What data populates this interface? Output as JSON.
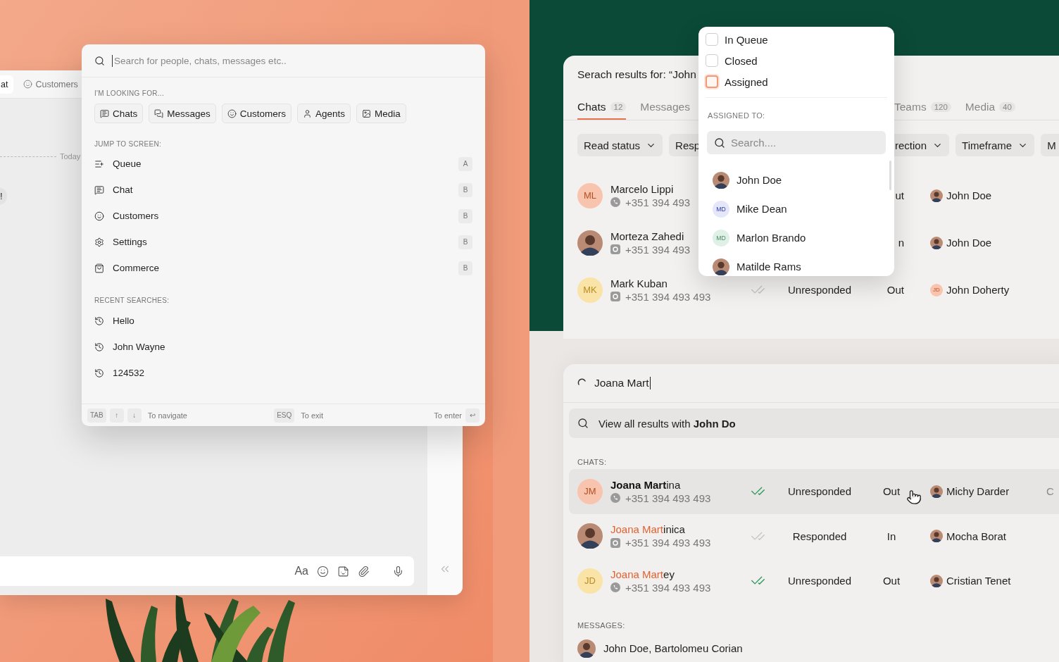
{
  "chat_window": {
    "tabs": [
      {
        "label": "at",
        "selected": true
      },
      {
        "label": "Customers",
        "selected": false
      }
    ],
    "divider_label": "Today",
    "message_fragment": "!",
    "composer": {
      "format_label": "Aa"
    }
  },
  "search_palette": {
    "placeholder": "Search for people, chats, messages etc..",
    "looking_for": {
      "heading": "I'M LOOKING FOR...",
      "chips": [
        "Chats",
        "Messages",
        "Customers",
        "Agents",
        "Media"
      ]
    },
    "jump_to": {
      "heading": "JUMP TO SCREEN:",
      "items": [
        {
          "label": "Queue",
          "key": "A"
        },
        {
          "label": "Chat",
          "key": "B"
        },
        {
          "label": "Customers",
          "key": "B"
        },
        {
          "label": "Settings",
          "key": "B"
        },
        {
          "label": "Commerce",
          "key": "B"
        }
      ]
    },
    "recent": {
      "heading": "RECENT SEARCHES:",
      "items": [
        "Hello",
        "John Wayne",
        "124532"
      ]
    },
    "footer": {
      "navigate_keys": [
        "TAB",
        "↑",
        "↓"
      ],
      "navigate_label": "To navigate",
      "exit_key": "ESQ",
      "exit_label": "To exit",
      "enter_label": "To enter",
      "enter_key": "↩"
    }
  },
  "results_window": {
    "title": "Serach results for: “John",
    "tabs": [
      {
        "label": "Chats",
        "count": "12",
        "selected": true
      },
      {
        "label": "Messages",
        "selected": false
      }
    ],
    "tabs_right": [
      {
        "label": "Teams",
        "count": "120",
        "selected": false
      },
      {
        "label": "Media",
        "count": "40",
        "selected": false
      }
    ],
    "filters": [
      {
        "label": "Read status",
        "caret": true
      },
      {
        "label": "Resp",
        "caret": false
      }
    ],
    "filters_right": [
      {
        "label": "rection",
        "caret": true
      },
      {
        "label": "Timeframe",
        "caret": true
      },
      {
        "label": "M",
        "caret": false
      }
    ],
    "rows": [
      {
        "name": "Marcelo Lippi",
        "phone": {
          "number": "+351 394 493",
          "kind": "whatsapp"
        },
        "avatar": {
          "kind": "initials",
          "text": "ML",
          "color": "#f8c4ad"
        },
        "direction": "ut",
        "agent": {
          "name": "John Doe"
        }
      },
      {
        "name": "Morteza Zahedi",
        "phone": {
          "number": "+351 394 493",
          "kind": "instagram"
        },
        "direction": "n",
        "agent": {
          "name": "John Doe"
        }
      },
      {
        "name": "Mark Kuban",
        "phone": {
          "number": "+351 394 493 493",
          "kind": "instagram"
        },
        "avatar": {
          "kind": "initials",
          "text": "MK",
          "color": "#fae3a6"
        },
        "read": false,
        "status": "Unresponded",
        "direction": "Out",
        "agent": {
          "name": "John Doherty",
          "avatar": {
            "kind": "initials",
            "text": "JD",
            "color": "#f8c4ad"
          }
        }
      }
    ]
  },
  "filter_dropdown": {
    "options": [
      {
        "label": "In Queue",
        "checked": false,
        "focused": false
      },
      {
        "label": "Closed",
        "checked": false,
        "focused": false
      },
      {
        "label": "Assigned",
        "checked": false,
        "focused": true
      }
    ],
    "heading": "ASSIGNED TO:",
    "search_placeholder": "Search....",
    "people": [
      {
        "name": "John Doe"
      },
      {
        "name": "Mike Dean",
        "avatar": {
          "kind": "initials",
          "text": "MD",
          "color": "#e4e6fa"
        }
      },
      {
        "name": "Marlon Brando",
        "avatar": {
          "kind": "initials",
          "text": "MD",
          "color": "#dff0e6"
        }
      },
      {
        "name": "Matilde Rams"
      }
    ]
  },
  "live_search": {
    "value": "Joana Mart",
    "view_all": "View all results with **John Do**",
    "chats_heading": "CHATS:",
    "chats": [
      {
        "name_match": "Joana Mart",
        "name_rest": "ina",
        "hovered": true,
        "phone": {
          "number": "+351 394 493 493",
          "kind": "whatsapp"
        },
        "avatar": {
          "kind": "initials",
          "text": "JM",
          "color": "#f8c4ad"
        },
        "read": true,
        "status": "Unresponded",
        "direction": "Out",
        "agent": {
          "name": "Michy Darder"
        },
        "column_7": "C"
      },
      {
        "name_match": "Joana Mart",
        "name_rest": "inica",
        "hovered": false,
        "phone": {
          "number": "+351 394 493 493",
          "kind": "instagram"
        },
        "read": false,
        "status": "Responded",
        "direction": "In",
        "agent": {
          "name": "Mocha Borat"
        }
      },
      {
        "name_match": "Joana Mart",
        "name_rest": "ey",
        "hovered": false,
        "phone": {
          "number": "+351 394 493 493",
          "kind": "whatsapp"
        },
        "avatar": {
          "kind": "initials",
          "text": "JD",
          "color": "#fae3a6"
        },
        "read": true,
        "status": "Unresponded",
        "direction": "Out",
        "agent": {
          "name": "Cristian Tenet"
        }
      }
    ],
    "messages_heading": "MESSAGES:",
    "messages": [
      {
        "title": "John Doe, Bartolomeu Corian"
      }
    ]
  }
}
